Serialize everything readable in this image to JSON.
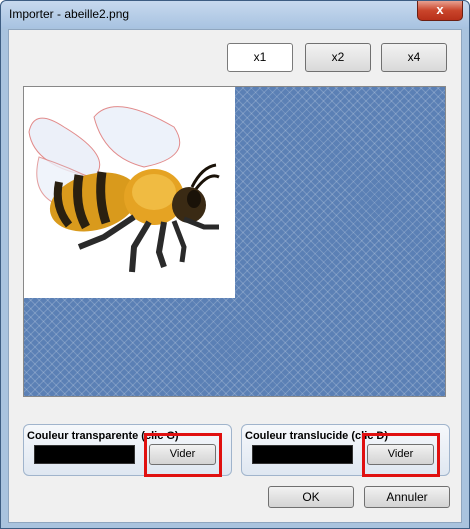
{
  "window": {
    "title": "Importer - abeille2.png",
    "close_label": "x"
  },
  "zoom": {
    "buttons": [
      "x1",
      "x2",
      "x4"
    ],
    "selected": "x1"
  },
  "transparent": {
    "label": "Couleur transparente (clic G)",
    "button": "Vider",
    "color": "#000000"
  },
  "translucent": {
    "label": "Couleur translucide (clic D)",
    "button": "Vider",
    "color": "#000000"
  },
  "footer": {
    "ok": "OK",
    "cancel": "Annuler"
  },
  "colors": {
    "preview_bg": "#5b80b5",
    "highlight": "#e01010"
  },
  "icons": {
    "preview_image": "bee-illustration"
  }
}
